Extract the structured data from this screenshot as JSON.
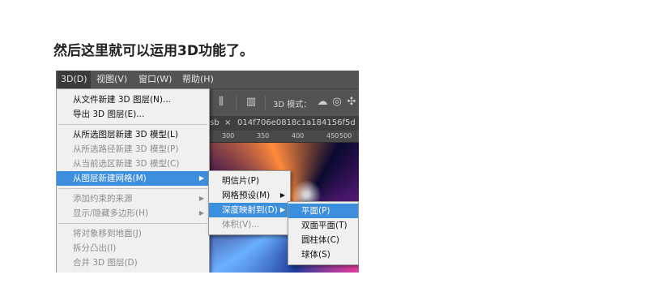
{
  "caption": "然后这里就可以运用3D功能了。",
  "menubar": [
    "3D(D)",
    "视图(V)",
    "窗口(W)",
    "帮助(H)"
  ],
  "toolbar": {
    "mode_label": "3D 模式："
  },
  "tabs": {
    "tab1": "sb",
    "tab2": "014f706e0818c1a184156f5d"
  },
  "ruler": [
    "300",
    "350",
    "400",
    "450",
    "500"
  ],
  "menu_3d": {
    "new_from_file": "从文件新建 3D 图层(N)...",
    "export_layer": "导出 3D 图层(E)...",
    "new_model_from_layer": "从所选图层新建 3D 模型(L)",
    "new_model_from_path": "从所选路径新建 3D 模型(P)",
    "new_model_from_selection": "从当前选区新建 3D 模型(C)",
    "new_mesh_from_layer": "从图层新建网格(M)",
    "add_constraint_source": "添加约束的来源",
    "show_hide_polygons": "显示/隐藏多边形(H)",
    "move_to_ground": "将对象移到地面(J)",
    "split_extrusion": "拆分凸出(I)",
    "merge_layers": "合并 3D 图层(D)"
  },
  "submenu_mesh": {
    "postcard": "明信片(P)",
    "mesh_preset": "网格预设(M)",
    "depth_map_to": "深度映射到(D)",
    "volume": "体积(V)..."
  },
  "submenu_depth": {
    "plane": "平面(P)",
    "two_sided_plane": "双面平面(T)",
    "cylinder": "圆柱体(C)",
    "sphere": "球体(S)"
  }
}
